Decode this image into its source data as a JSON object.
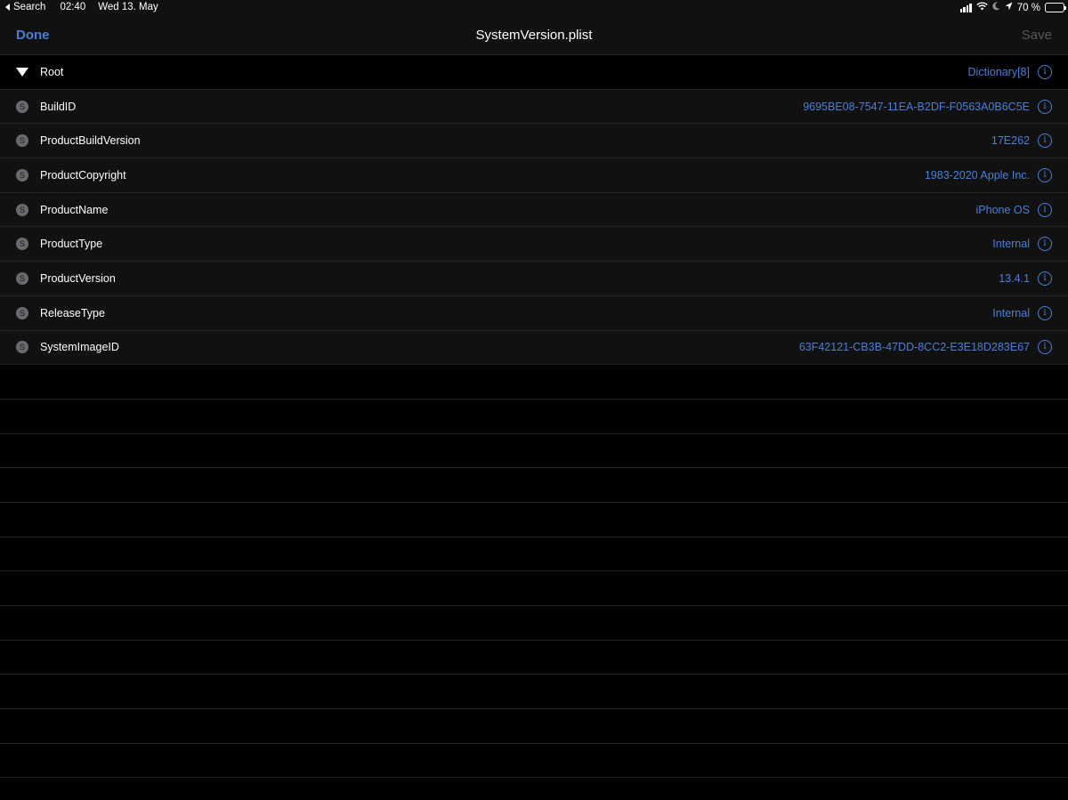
{
  "status_bar": {
    "back_label": "Search",
    "time": "02:40",
    "date": "Wed 13. May",
    "battery_text": "70 %",
    "battery_level": 0.7,
    "icons": [
      "signal-icon",
      "wifi-icon",
      "moon-icon",
      "location-icon",
      "battery-icon"
    ]
  },
  "nav": {
    "done_label": "Done",
    "title": "SystemVersion.plist",
    "save_label": "Save"
  },
  "root": {
    "key": "Root",
    "value": "Dictionary[8]"
  },
  "entries": [
    {
      "key": "BuildID",
      "type_badge": "S",
      "value": "9695BE08-7547-11EA-B2DF-F0563A0B6C5E"
    },
    {
      "key": "ProductBuildVersion",
      "type_badge": "S",
      "value": "17E262"
    },
    {
      "key": "ProductCopyright",
      "type_badge": "S",
      "value": "1983-2020 Apple Inc."
    },
    {
      "key": "ProductName",
      "type_badge": "S",
      "value": "iPhone OS"
    },
    {
      "key": "ProductType",
      "type_badge": "S",
      "value": "Internal"
    },
    {
      "key": "ProductVersion",
      "type_badge": "S",
      "value": "13.4.1"
    },
    {
      "key": "ReleaseType",
      "type_badge": "S",
      "value": "Internal"
    },
    {
      "key": "SystemImageID",
      "type_badge": "S",
      "value": "63F42121-CB3B-47DD-8CC2-E3E18D283E67"
    }
  ],
  "colors": {
    "accent": "#4a7fd8",
    "background": "#000000",
    "row_background": "#111112",
    "disabled": "#58585c"
  }
}
